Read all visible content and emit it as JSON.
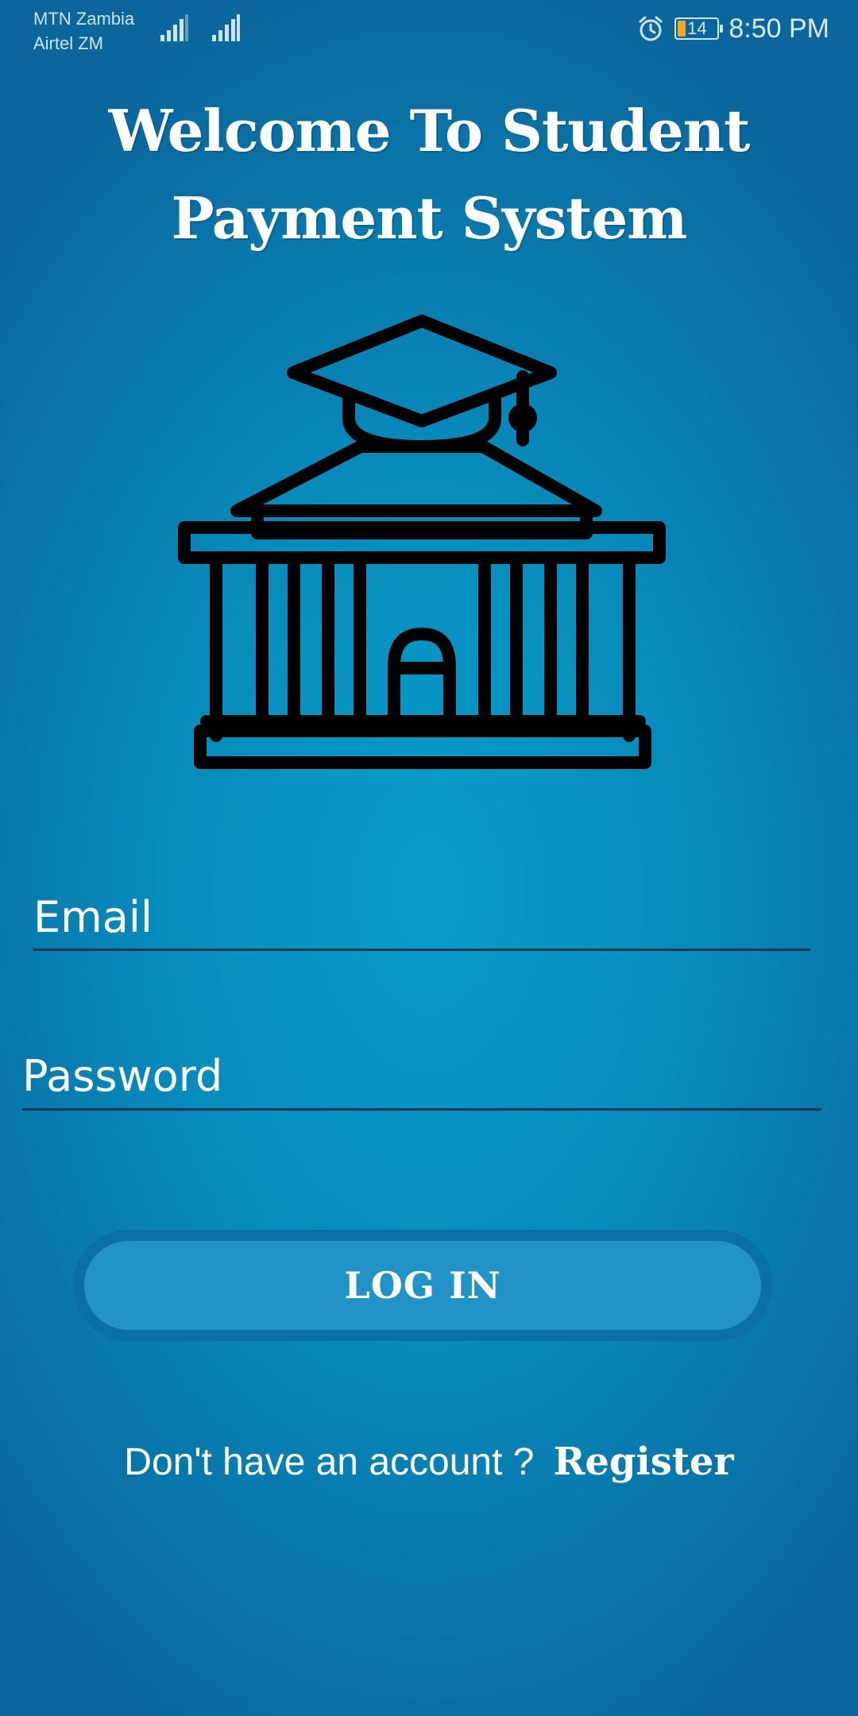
{
  "status_bar": {
    "carrier_1": "MTN Zambia",
    "carrier_2": "Airtel ZM",
    "battery_level": "14",
    "time": "8:50 PM",
    "icons": [
      "signal-icon",
      "signal-icon",
      "alarm-icon",
      "battery-icon"
    ],
    "battery_color": "#f5a623"
  },
  "header": {
    "title": "Welcome To Student Payment System"
  },
  "illustration": {
    "icon": "university-graduation-cap-icon"
  },
  "form": {
    "email_placeholder": "Email",
    "password_placeholder": "Password",
    "login_label": "LOG IN"
  },
  "register": {
    "prompt": "Don't have an account ?",
    "link_label": "Register"
  },
  "colors": {
    "background_center": "#0a9dcb",
    "background_edge": "#0b669c",
    "button_fill": "#2293c6",
    "button_border": "#0a6fa6",
    "text": "#ffffff"
  }
}
